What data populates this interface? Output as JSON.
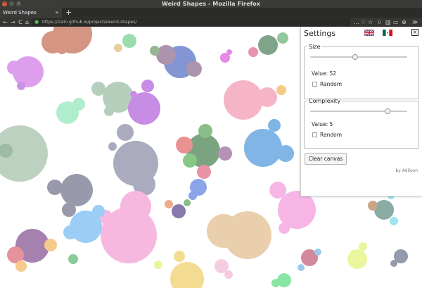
{
  "window": {
    "title": "Weird Shapes - Mozilla Firefox"
  },
  "tabs": [
    {
      "label": "Weird Shapes",
      "close_symbol": "×"
    }
  ],
  "new_tab_symbol": "+",
  "toolbar": {
    "back_symbol": "←",
    "forward_symbol": "→",
    "reload_symbol": "C",
    "home_symbol": "⌂",
    "url": "https://2alin.github.io/projects/weird-shapes/",
    "menu_symbols": [
      "…",
      "♡",
      "☆",
      "⇩",
      "▥",
      "▭",
      "⊕",
      "≫"
    ]
  },
  "settings": {
    "title": "Settings",
    "close_symbol": "×",
    "languages": [
      "english-flag-icon",
      "mexico-flag-icon"
    ],
    "size": {
      "legend": "Size",
      "value_label": "Value: 52",
      "value": 52,
      "min": 10,
      "max": 100,
      "random_label": "Random",
      "random_checked": false
    },
    "complexity": {
      "legend": "Complexity",
      "value_label": "Value: 5",
      "value": 5,
      "min": 1,
      "max": 6,
      "random_label": "Random",
      "random_checked": false
    },
    "clear_label": "Clear canvas",
    "byline": "by Adiloon"
  },
  "colors": {
    "accent": "#1e1e1e"
  }
}
